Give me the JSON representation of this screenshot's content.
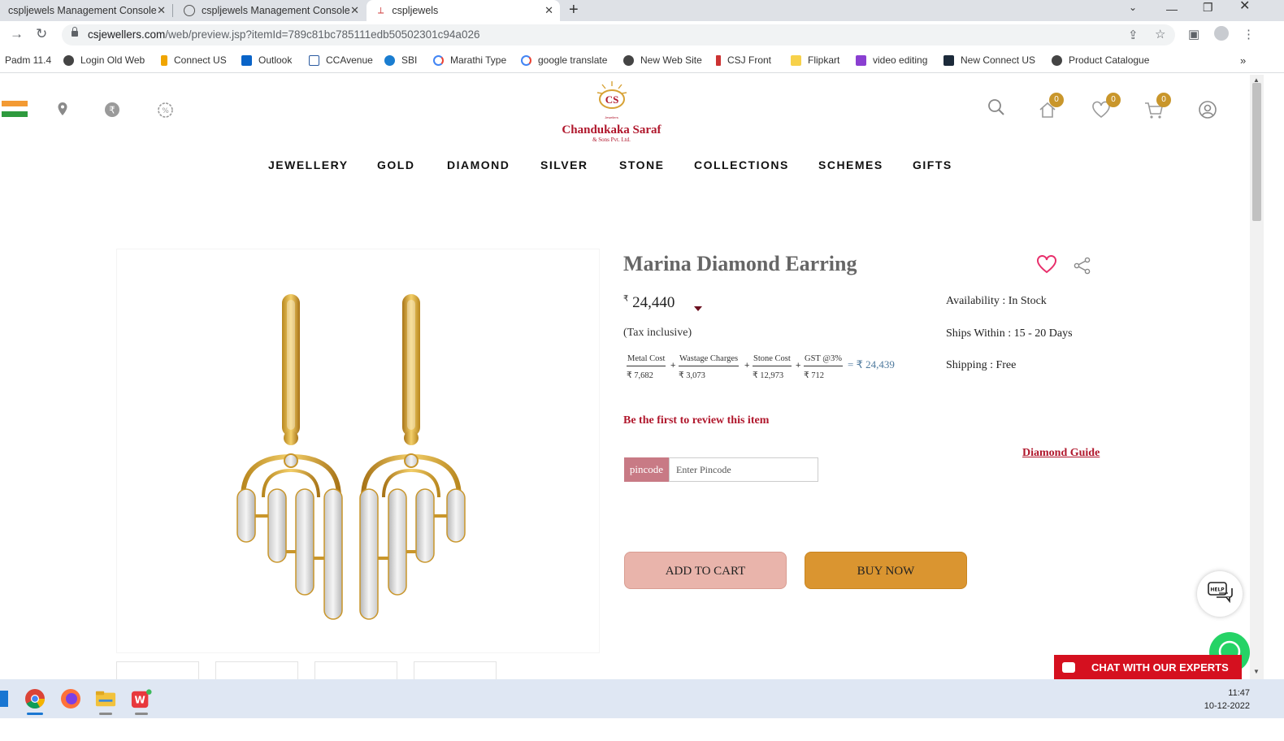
{
  "browser": {
    "tabs": [
      {
        "title": "cspljewels Management Console"
      },
      {
        "title": "cspljewels Management Console"
      },
      {
        "title": "cspljewels"
      }
    ],
    "url_host": "csjewellers.com",
    "url_rest": "/web/preview.jsp?itemId=789c81bc785111edb50502301c94a026",
    "bookmarks": [
      {
        "label": "Padm 11.4"
      },
      {
        "label": "Login Old Web"
      },
      {
        "label": "Connect US"
      },
      {
        "label": "Outlook"
      },
      {
        "label": "CCAvenue"
      },
      {
        "label": "SBI"
      },
      {
        "label": "Marathi Type"
      },
      {
        "label": "google translate"
      },
      {
        "label": "New Web Site"
      },
      {
        "label": "CSJ Front"
      },
      {
        "label": "Flipkart"
      },
      {
        "label": "video editing"
      },
      {
        "label": "New Connect US"
      },
      {
        "label": "Product Catalogue"
      }
    ]
  },
  "header": {
    "logo_mark": "CS",
    "logo_tiny": "Jewellers",
    "logo_name": "Chandukaka Saraf",
    "logo_sub": "& Sons Pvt. Ltd.",
    "cart_count": "0",
    "wishlist_count": "0",
    "home_count": "0"
  },
  "nav": [
    "JEWELLERY",
    "GOLD",
    "DIAMOND",
    "SILVER",
    "STONE",
    "COLLECTIONS",
    "SCHEMES",
    "GIFTS"
  ],
  "product": {
    "title": "Marina Diamond Earring",
    "currency": "₹",
    "price": "24,440",
    "tax_note": "(Tax inclusive)",
    "breakdown": [
      {
        "label": "Metal Cost",
        "value": "₹ 7,682"
      },
      {
        "label": "Wastage Charges",
        "value": "₹ 3,073"
      },
      {
        "label": "Stone Cost",
        "value": "₹ 12,973"
      },
      {
        "label": "GST @3%",
        "value": "₹ 712"
      }
    ],
    "plus": "+",
    "breakdown_total": "= ₹ 24,439",
    "availability": "Availability : In Stock",
    "ships": "Ships Within : 15 - 20 Days",
    "shipping": "Shipping : Free",
    "review_prompt": "Be the first to review this item",
    "diamond_guide": "Diamond Guide",
    "pincode_label": "pincode",
    "pincode_placeholder": "Enter Pincode",
    "add_to_cart": "ADD TO CART",
    "buy_now": "BUY NOW"
  },
  "help_label": "HELP",
  "chat_label": "CHAT WITH OUR EXPERTS",
  "taskbar": {
    "time": "11:47",
    "date": "10-12-2022"
  },
  "colors": {
    "brand_red": "#b0172c",
    "gold": "#da9530",
    "pink_btn": "#e9b4ab",
    "badge": "#c9962b"
  }
}
